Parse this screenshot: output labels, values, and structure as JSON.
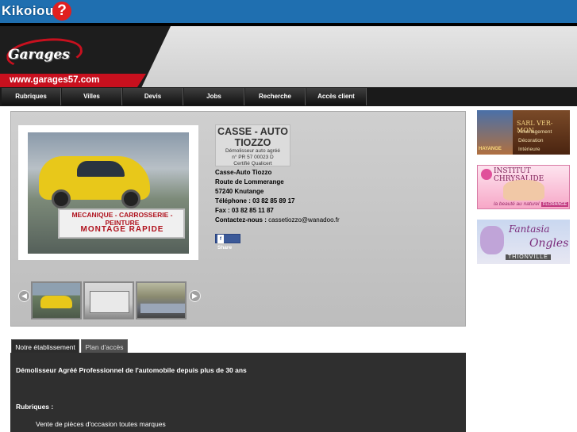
{
  "topbar": {
    "logo_text": "Kikoiou",
    "logo_q": "?"
  },
  "header": {
    "logo": "Garages",
    "url": "www.garages57.com"
  },
  "nav": {
    "items": [
      {
        "label": "Rubriques"
      },
      {
        "label": "Villes"
      },
      {
        "label": "Devis"
      },
      {
        "label": "Jobs"
      },
      {
        "label": "Recherche"
      },
      {
        "label": "Accès client"
      }
    ]
  },
  "listing": {
    "photo_sign_line1": "MECANIQUE - CARROSSERIE - PEINTURE",
    "photo_sign_line2": "MONTAGE RAPIDE",
    "logo_title": "CASSE - AUTO TIOZZO",
    "logo_sub1": "Démolisseur auto agréé",
    "logo_sub2": "n° PR 57 00023 D",
    "logo_sub3": "Certifié Qualicert",
    "name": "Casse-Auto Tiozzo",
    "street": "Route de Lommerange",
    "city": "57240 Knutange",
    "phone": "Téléphone : 03 82 85 89 17",
    "fax": "Fax : 03 82 85 11 87",
    "contact_label": "Contactez-nous :",
    "contact_email": "cassetiozzo@wanadoo.fr",
    "share_label": "Share",
    "share_icon": "f"
  },
  "gallery": {
    "prev_icon": "◀",
    "next_icon": "▶"
  },
  "tabs": [
    {
      "label": "Notre établissement"
    },
    {
      "label": "Plan d'accès"
    }
  ],
  "tab_content": {
    "headline": "Démolisseur Agréé Professionnel de l'automobile depuis plus de 30 ans",
    "rubriques_label": "Rubriques :",
    "item": "Vente de pièces d'occasion toutes marques"
  },
  "ads": [
    {
      "brand": "SARL VER-MON",
      "line1": "Aménagement",
      "line2": "Décoration",
      "line3": "Intérieure",
      "city": "HAYANGE"
    },
    {
      "brand": "INSTITUT CHRYSALIDE",
      "tagline": "la beauté au naturel",
      "city": "FLORANGE"
    },
    {
      "brand1": "Fantasia",
      "brand2": "Ongles",
      "city": "THIONVILLE"
    }
  ]
}
